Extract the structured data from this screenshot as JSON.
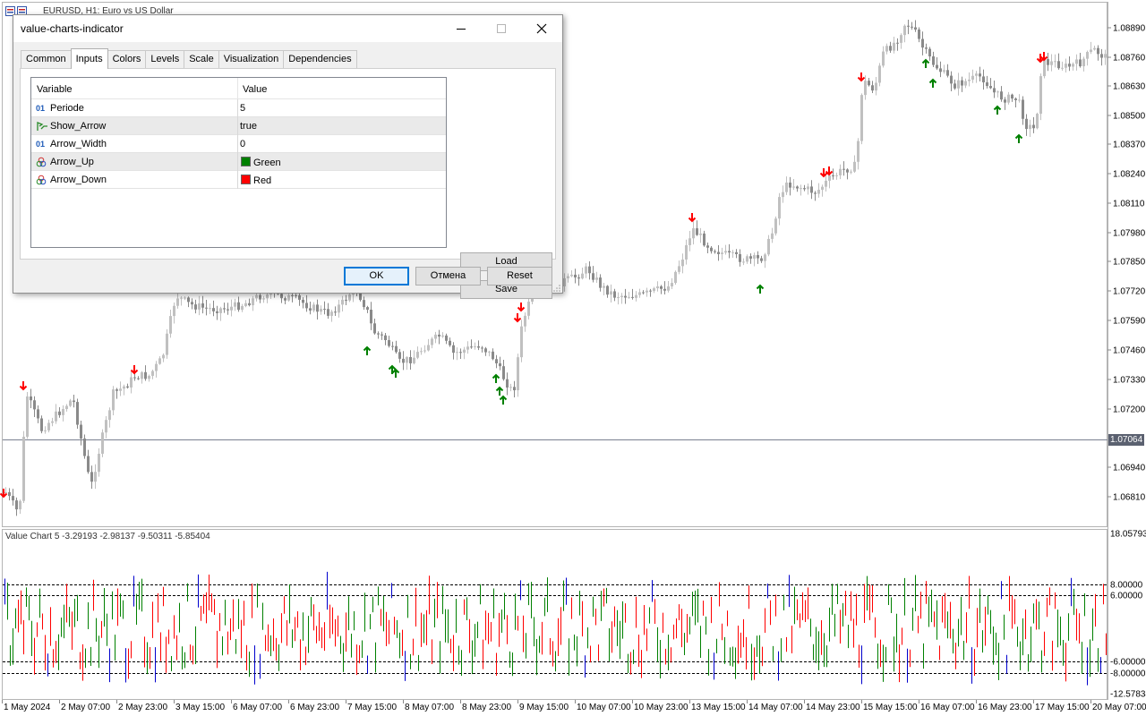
{
  "chart": {
    "symbol_title": "EURUSD, H1: Euro vs US Dollar",
    "current_price": "1.07064",
    "price_labels": [
      "1.08890",
      "1.08760",
      "1.08630",
      "1.08500",
      "1.08370",
      "1.08240",
      "1.08110",
      "1.07980",
      "1.07850",
      "1.07720",
      "1.07590",
      "1.07460",
      "1.07330",
      "1.07200",
      "1.06940",
      "1.06810"
    ],
    "subwindow_title": "Value Chart 5 -3.29193 -2.98137 -9.50311 -5.85404",
    "sub_labels": [
      "18.05793",
      "8.00000",
      "6.00000",
      "-6.00000",
      "-8.00000",
      "-12.57834"
    ],
    "time_labels": [
      "1 May 2024",
      "2 May 07:00",
      "2 May 23:00",
      "3 May 15:00",
      "6 May 07:00",
      "6 May 23:00",
      "7 May 15:00",
      "8 May 07:00",
      "8 May 23:00",
      "9 May 15:00",
      "10 May 07:00",
      "10 May 23:00",
      "13 May 15:00",
      "14 May 07:00",
      "14 May 23:00",
      "15 May 15:00",
      "16 May 07:00",
      "16 May 23:00",
      "17 May 15:00",
      "20 May 07:00"
    ],
    "colors": {
      "candle": "#c0c0c0",
      "candle_dark": "#8a8a8a",
      "arrow_up": "#008000",
      "arrow_down": "#ff0000",
      "vc_up": "#008000",
      "vc_down": "#ff0000",
      "vc_extreme": "#0000cd"
    }
  },
  "dialog": {
    "title": "value-charts-indicator",
    "tabs": [
      "Common",
      "Inputs",
      "Colors",
      "Levels",
      "Scale",
      "Visualization",
      "Dependencies"
    ],
    "active_tab": "Inputs",
    "columns": {
      "variable": "Variable",
      "value": "Value"
    },
    "rows": [
      {
        "variable": "Periode",
        "value": "5",
        "icon": "int-icon"
      },
      {
        "variable": "Show_Arrow",
        "value": "true",
        "icon": "bool-icon"
      },
      {
        "variable": "Arrow_Width",
        "value": "0",
        "icon": "int-icon"
      },
      {
        "variable": "Arrow_Up",
        "value": "Green",
        "icon": "color-icon",
        "swatch": "#008000"
      },
      {
        "variable": "Arrow_Down",
        "value": "Red",
        "icon": "color-icon",
        "swatch": "#ff0000"
      }
    ],
    "buttons": {
      "load": "Load",
      "save": "Save",
      "ok": "OK",
      "cancel": "Отмена",
      "reset": "Reset"
    }
  }
}
